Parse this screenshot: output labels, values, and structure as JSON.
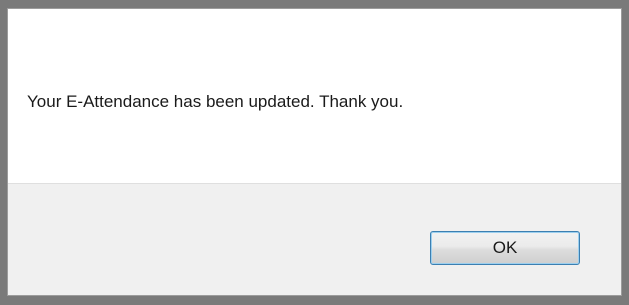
{
  "dialog": {
    "message": "Your E-Attendance has been updated. Thank you.",
    "ok_label": "OK"
  }
}
